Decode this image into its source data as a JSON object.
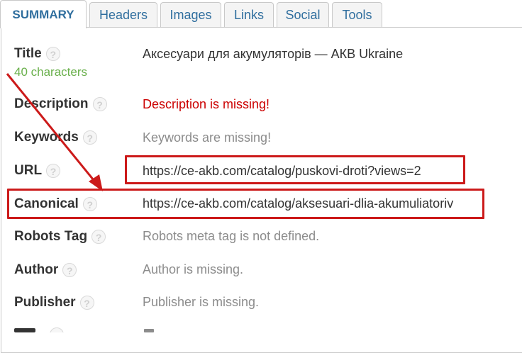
{
  "tabs": [
    "SUMMARY",
    "Headers",
    "Images",
    "Links",
    "Social",
    "Tools"
  ],
  "rows": {
    "title": {
      "label": "Title",
      "value": "Аксесуари для акумуляторів — АКВ Ukraine",
      "sub": "40 characters"
    },
    "description": {
      "label": "Description",
      "value": "Description is missing!"
    },
    "keywords": {
      "label": "Keywords",
      "value": "Keywords are missing!"
    },
    "url": {
      "label": "URL",
      "value": "https://ce-akb.com/catalog/puskovi-droti?views=2"
    },
    "canonical": {
      "label": "Canonical",
      "value": "https://ce-akb.com/catalog/aksesuari-dlia-akumuliatoriv"
    },
    "robots": {
      "label": "Robots Tag",
      "value": "Robots meta tag is not defined."
    },
    "author": {
      "label": "Author",
      "value": "Author is missing."
    },
    "publisher": {
      "label": "Publisher",
      "value": "Publisher is missing."
    }
  },
  "help_glyph": "?",
  "colors": {
    "tab_text": "#2f6e9e",
    "error": "#cc0000",
    "count": "#6ab04c",
    "highlight": "#cc1a1a"
  }
}
